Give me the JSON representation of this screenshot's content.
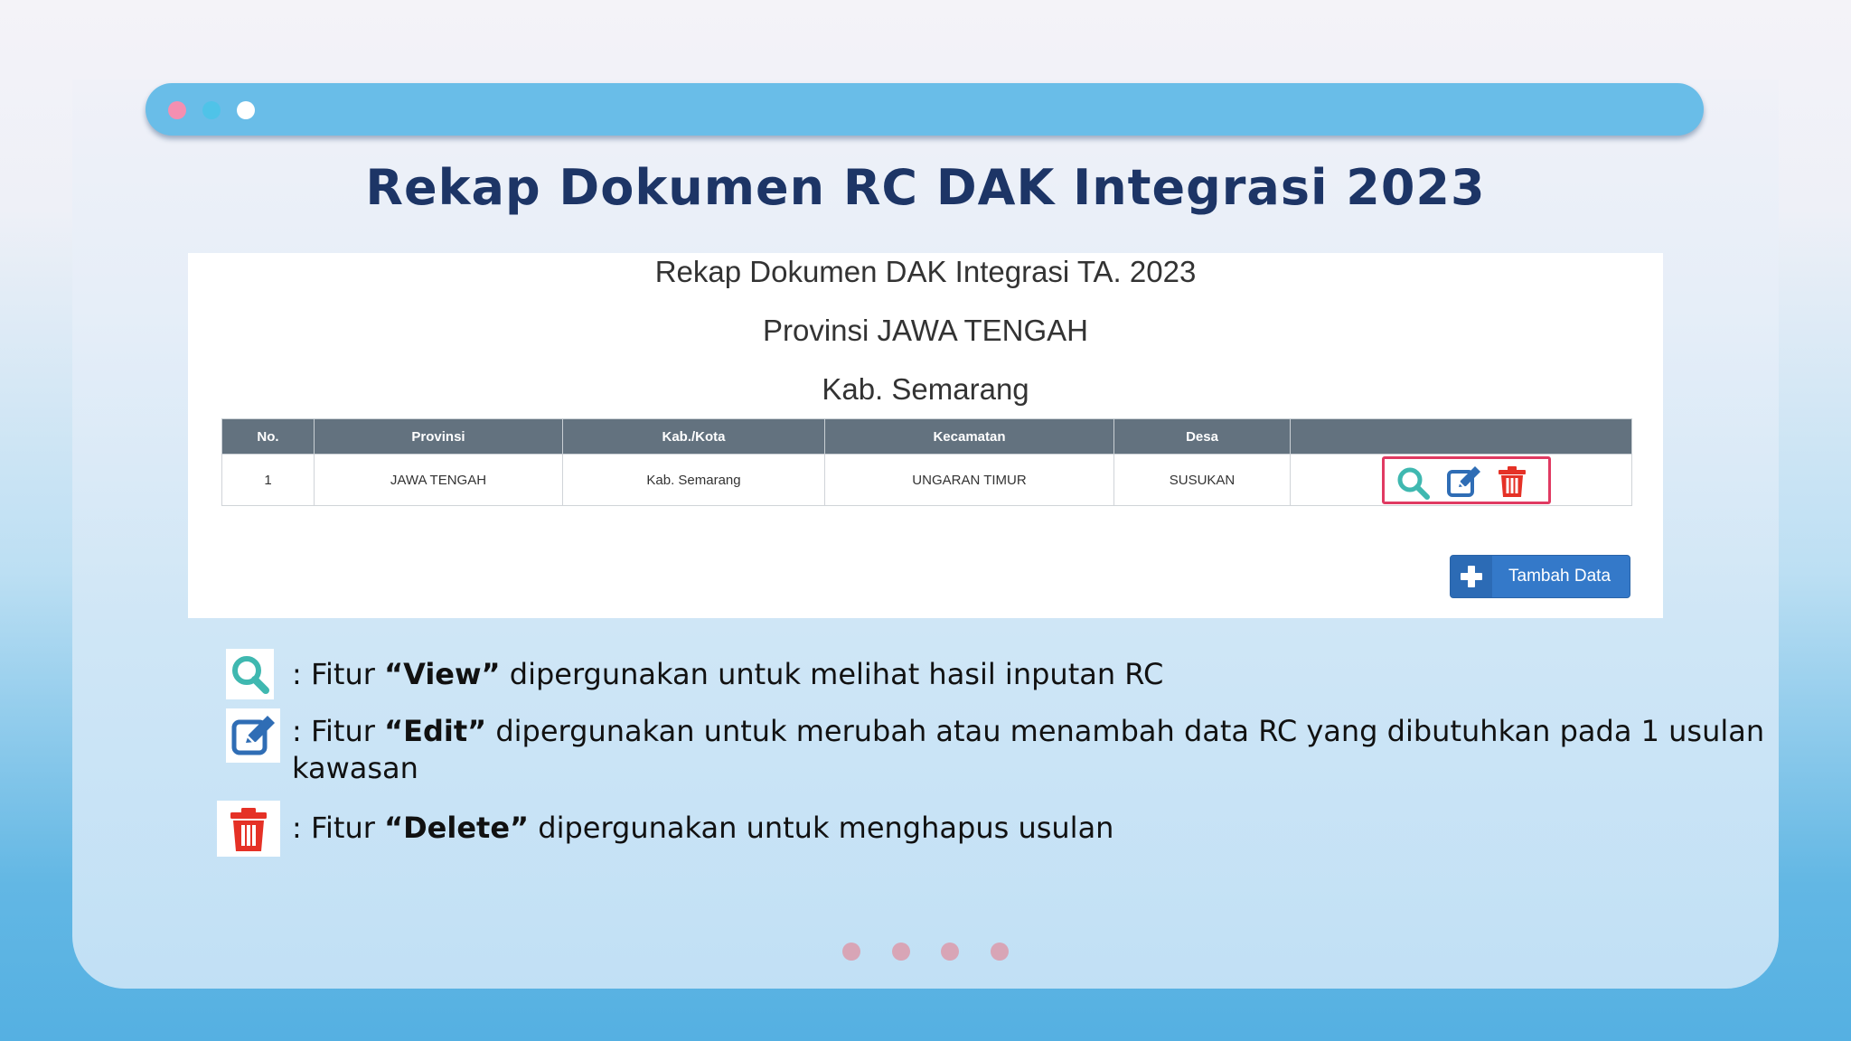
{
  "slide": {
    "title": "Rekap Dokumen RC DAK Integrasi 2023"
  },
  "window": {
    "dots": [
      "#f48fb1",
      "#4fc3e8",
      "#ffffff"
    ]
  },
  "screenshot": {
    "heading": "Rekap Dokumen DAK Integrasi TA. 2023",
    "province_line": "Provinsi JAWA TENGAH",
    "regency_line": "Kab. Semarang",
    "table": {
      "headers": [
        "No.",
        "Provinsi",
        "Kab./Kota",
        "Kecamatan",
        "Desa",
        ""
      ],
      "rows": [
        [
          "1",
          "JAWA TENGAH",
          "Kab. Semarang",
          "UNGARAN TIMUR",
          "SUSUKAN"
        ]
      ]
    },
    "actions": [
      "search-icon",
      "edit-icon",
      "trash-icon"
    ],
    "add_button": "Tambah Data"
  },
  "legend": [
    {
      "icon": "search-icon",
      "prefix": ": Fitur ",
      "feature": "“View”",
      "desc": " dipergunakan untuk melihat hasil inputan RC"
    },
    {
      "icon": "edit-icon",
      "prefix": ": Fitur ",
      "feature": "“Edit”",
      "desc": " dipergunakan untuk merubah atau menambah data RC yang dibutuhkan pada 1 usulan kawasan"
    },
    {
      "icon": "trash-icon",
      "prefix": ": Fitur ",
      "feature": "“Delete”",
      "desc": " dipergunakan untuk menghapus usulan"
    }
  ],
  "colors": {
    "accent": "#69bde8",
    "title": "#1d3566",
    "view": "#3fb8b0",
    "edit": "#2f6db5",
    "delete": "#e53126",
    "highlight": "#e03a62"
  },
  "pagination": {
    "count": 4
  }
}
